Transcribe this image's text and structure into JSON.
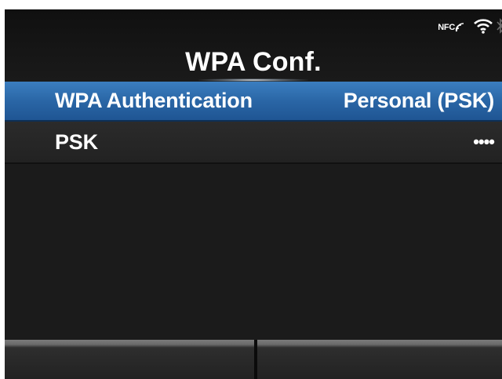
{
  "header": {
    "title": "WPA Conf.",
    "status": {
      "nfc_label": "NFC",
      "icons": [
        "nfc-icon",
        "wifi-icon",
        "bluetooth-icon"
      ]
    }
  },
  "menu": {
    "items": [
      {
        "label": "WPA Authentication",
        "value": "Personal (PSK)",
        "selected": true
      },
      {
        "label": "PSK",
        "value": "••••",
        "selected": false
      }
    ]
  },
  "softkeys": {
    "left_label": "",
    "right_label": ""
  },
  "colors": {
    "selection": "#2a66a6",
    "background": "#1b1b1b",
    "text": "#ffffff"
  }
}
